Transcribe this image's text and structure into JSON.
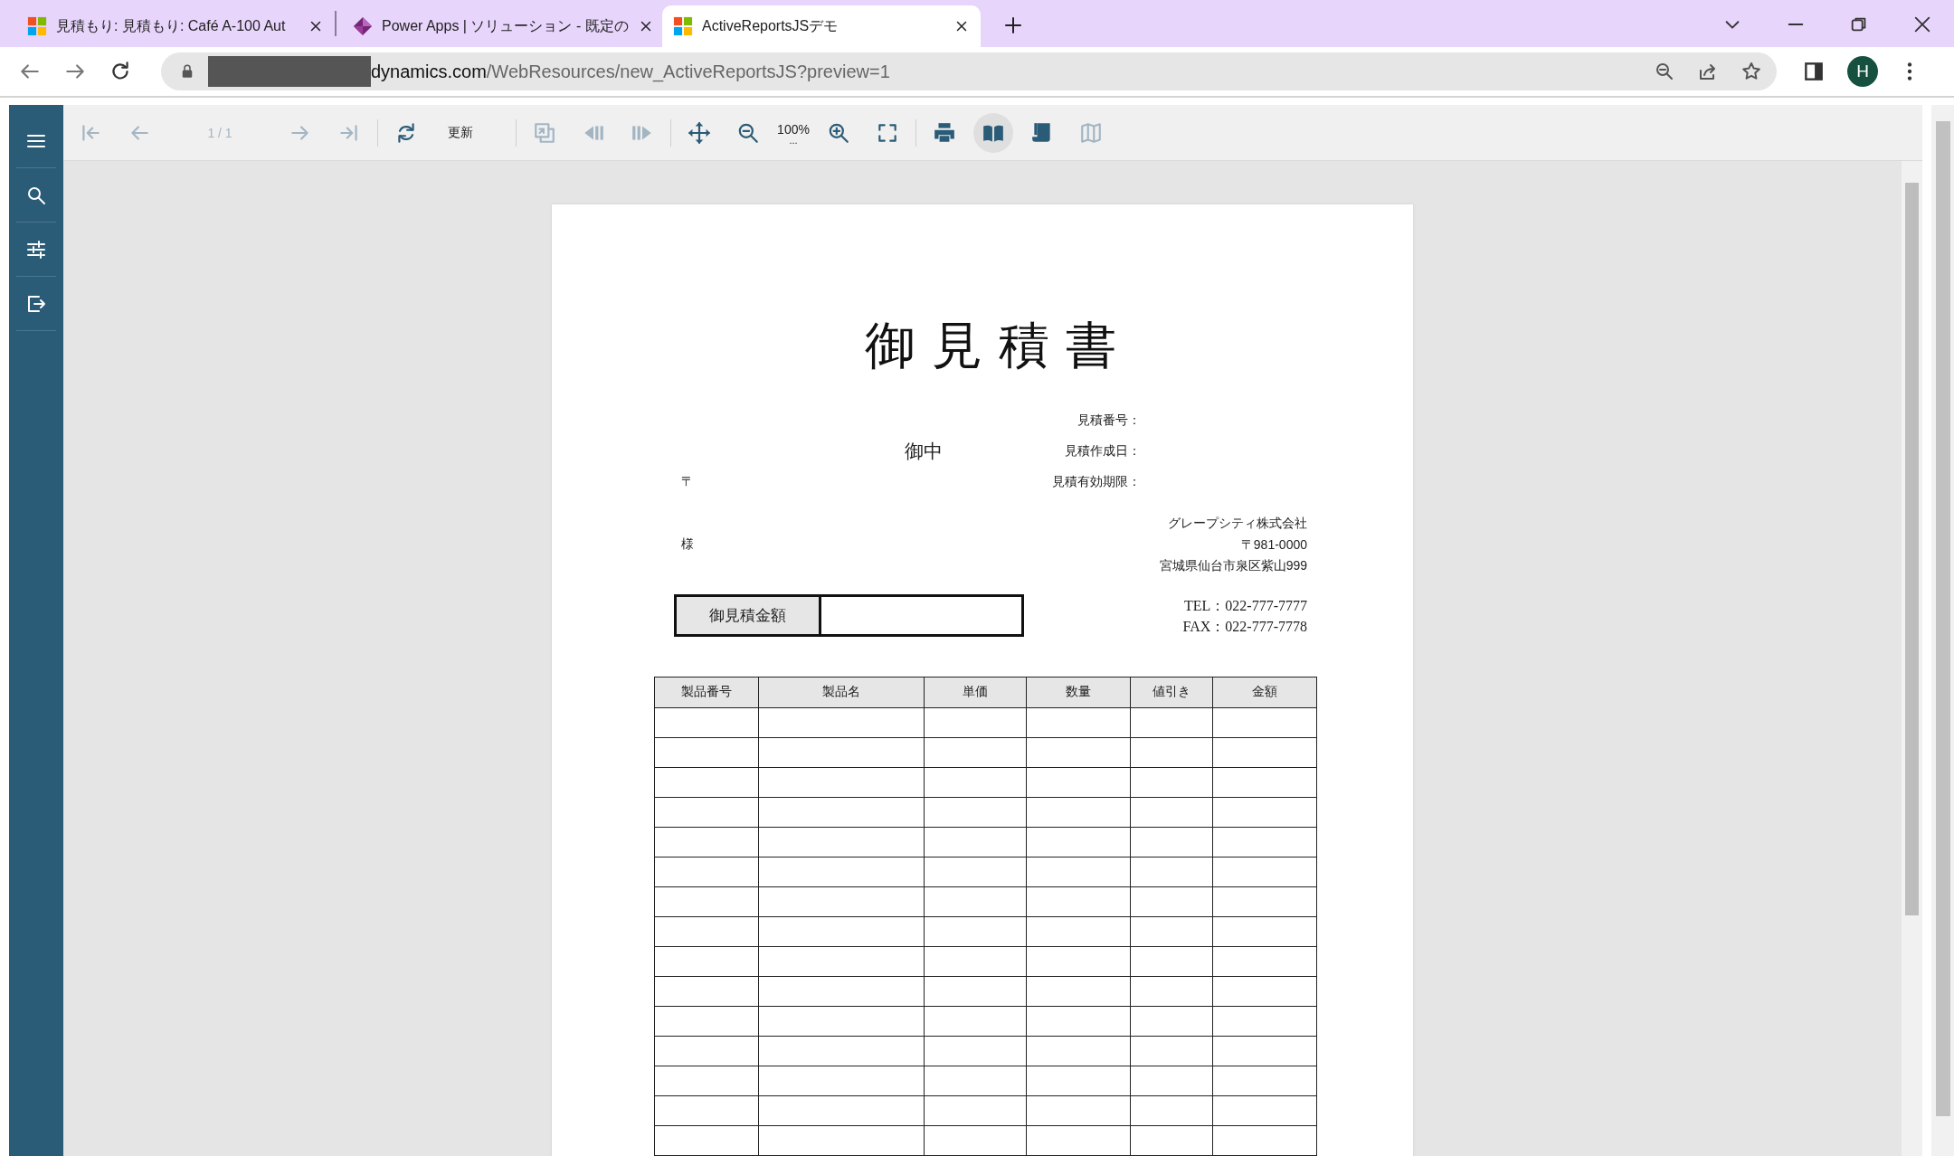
{
  "browser": {
    "tabs": [
      {
        "title": "見積もり: 見積もり: Café A-100 Aut",
        "kind": "squares",
        "selected": false
      },
      {
        "title": "Power Apps | ソリューション - 既定の",
        "kind": "diamond",
        "selected": false
      },
      {
        "title": "ActiveReportsJSデモ",
        "kind": "squares",
        "selected": true
      }
    ],
    "address": {
      "host": "dynamics.com",
      "path": "/WebResources/new_ActiveReportsJS?preview=1"
    },
    "avatar": "H"
  },
  "viewer": {
    "toolbar": {
      "items": [
        {
          "kind": "first-page",
          "disabled": true
        },
        {
          "kind": "previous-page",
          "disabled": true
        },
        {
          "kind": "page-number",
          "text": "1 / 1",
          "disabled": true
        },
        {
          "kind": "next-page",
          "disabled": true
        },
        {
          "kind": "last-page",
          "disabled": true
        },
        {
          "kind": "separator"
        },
        {
          "kind": "refresh",
          "disabled": false
        },
        {
          "kind": "label",
          "text": "更新",
          "disabled": false
        },
        {
          "kind": "separator"
        },
        {
          "kind": "parent-report",
          "disabled": true
        },
        {
          "kind": "previous-section",
          "disabled": true
        },
        {
          "kind": "next-section",
          "disabled": true
        },
        {
          "kind": "separator"
        },
        {
          "kind": "pan",
          "disabled": false
        },
        {
          "kind": "zoom-out",
          "disabled": false
        },
        {
          "kind": "zoom-level",
          "text": "100%",
          "hint": "...",
          "disabled": false
        },
        {
          "kind": "zoom-in",
          "disabled": false
        },
        {
          "kind": "fullscreen",
          "disabled": false
        },
        {
          "kind": "separator"
        },
        {
          "kind": "print",
          "disabled": false
        }
      ],
      "view_modes": [
        {
          "kind": "single-page",
          "selected": true,
          "disabled": false
        },
        {
          "kind": "continuous",
          "selected": false,
          "disabled": false
        },
        {
          "kind": "galley",
          "selected": false,
          "disabled": true
        }
      ]
    }
  },
  "report": {
    "title": "御 見 積 書",
    "fields": [
      {
        "label": "見積番号："
      },
      {
        "label": "見積作成日："
      },
      {
        "label": "見積有効期限："
      }
    ],
    "recipient_suffix": "御中",
    "postal_mark": "〒",
    "honorific": "様",
    "issuer": [
      "グレープシティ株式会社",
      "〒981-0000",
      "宮城県仙台市泉区紫山999"
    ],
    "contact": [
      "TEL：022-777-7777",
      "FAX：022-777-7778"
    ],
    "amount_label": "御見積金額",
    "table": {
      "columns": [
        "製品番号",
        "製品名",
        "単価",
        "数量",
        "値引き",
        "金額"
      ]
    }
  }
}
